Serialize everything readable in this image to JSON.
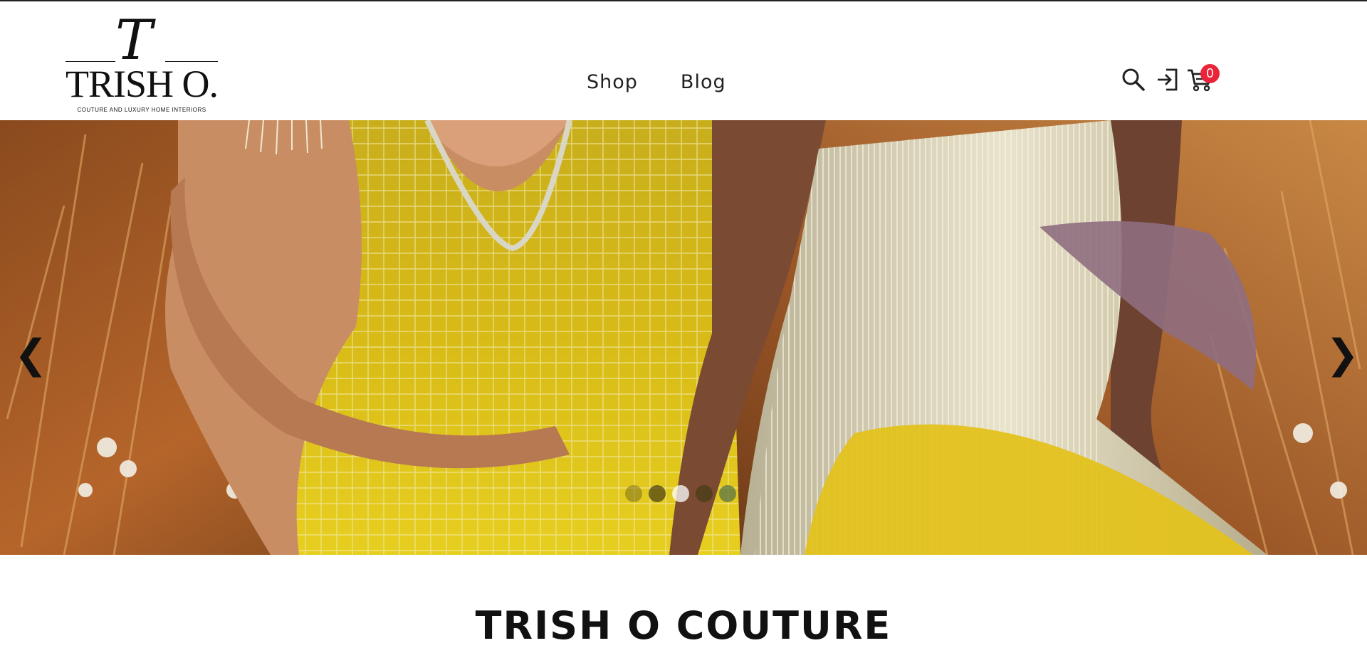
{
  "brand": {
    "monogram": "T",
    "wordmark": "TRISH O.",
    "tagline": "COUTURE AND LUXURY HOME INTERIORS"
  },
  "nav": {
    "items": [
      {
        "label": "Shop"
      },
      {
        "label": "Blog"
      }
    ]
  },
  "header_icons": {
    "search": "search-icon",
    "login": "login-icon",
    "cart": "cart-icon",
    "cart_count": "0",
    "badge_color": "#e8253a"
  },
  "hero": {
    "prev": "❮",
    "next": "❯",
    "slide_count": 5,
    "active_slide": 3
  },
  "section": {
    "title": "TRISH O COUTURE"
  }
}
